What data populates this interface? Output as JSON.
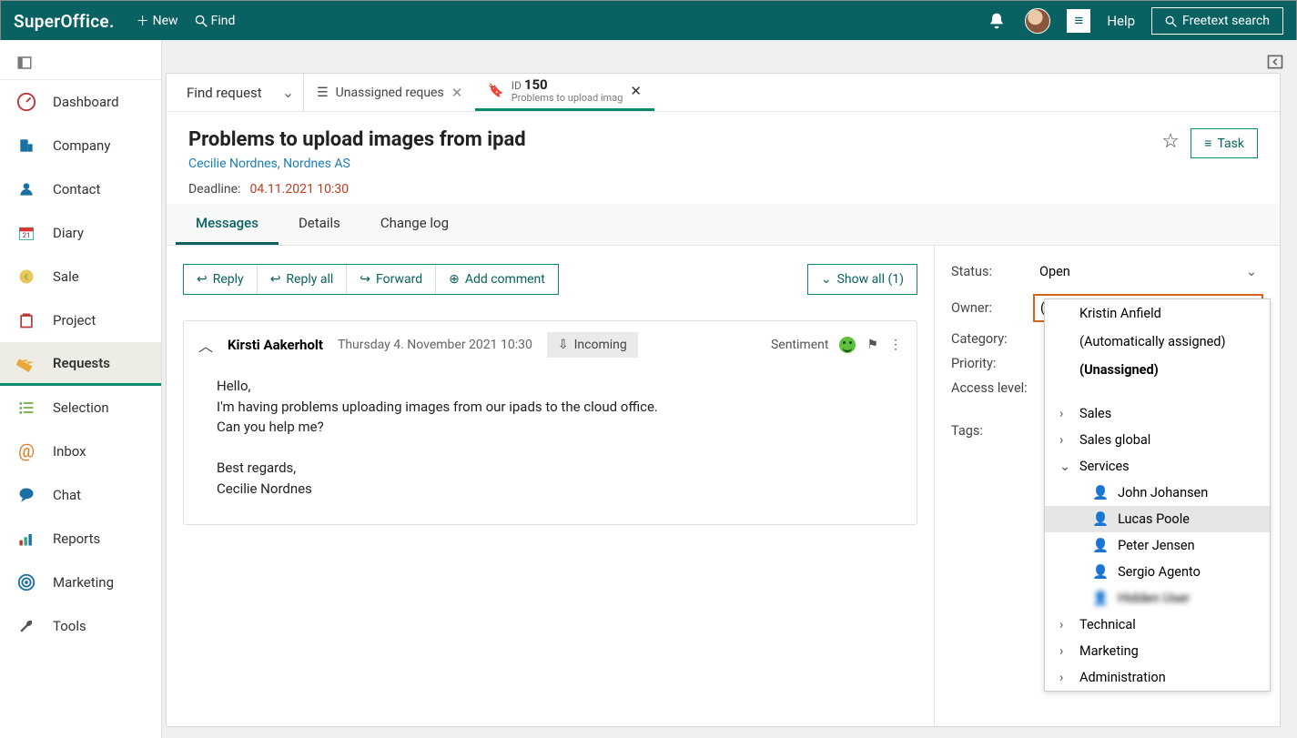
{
  "top": {
    "logo": "SuperOffice",
    "new": "New",
    "find": "Find",
    "help": "Help",
    "freetext": "Freetext search"
  },
  "nav": {
    "items": [
      "Dashboard",
      "Company",
      "Contact",
      "Diary",
      "Sale",
      "Project",
      "Requests",
      "Selection",
      "Inbox",
      "Chat",
      "Reports",
      "Marketing",
      "Tools"
    ],
    "active": "Requests"
  },
  "tabs": {
    "find": "Find request",
    "unassigned": "Unassigned reques",
    "active_id_label": "ID",
    "active_id": "150",
    "active_sub": "Problems to upload imag"
  },
  "request": {
    "title": "Problems to upload images from ipad",
    "contact": "Cecilie Nordnes, Nordnes AS",
    "deadline_label": "Deadline:",
    "deadline_value": "04.11.2021 10:30",
    "task": "Task"
  },
  "subtabs": [
    "Messages",
    "Details",
    "Change log"
  ],
  "actions": {
    "reply": "Reply",
    "reply_all": "Reply all",
    "forward": "Forward",
    "add_comment": "Add comment",
    "show_all": "Show all (1)"
  },
  "message": {
    "author": "Kirsti Aakerholt",
    "time": "Thursday 4. November 2021 10:30",
    "direction": "Incoming",
    "sentiment_label": "Sentiment",
    "body": "Hello,\nI'm having problems uploading images from our ipads to the cloud office.\nCan you help me?\n\nBest regards,\nCecilie Nordnes"
  },
  "details": {
    "status_label": "Status:",
    "status_value": "Open",
    "owner_label": "Owner:",
    "owner_value": "(Unassigned)",
    "category_label": "Category:",
    "priority_label": "Priority:",
    "access_label": "Access level:",
    "tags_label": "Tags:"
  },
  "owner_dropdown": {
    "recent": [
      "Kristin Anfield",
      "(Automatically assigned)",
      "(Unassigned)"
    ],
    "groups": [
      {
        "name": "Sales",
        "open": false
      },
      {
        "name": "Sales global",
        "open": false
      },
      {
        "name": "Services",
        "open": true,
        "users": [
          "John Johansen",
          "Lucas Poole",
          "Peter Jensen",
          "Sergio Agento",
          "blurred"
        ]
      },
      {
        "name": "Technical",
        "open": false
      },
      {
        "name": "Marketing",
        "open": false
      },
      {
        "name": "Administration",
        "open": false
      }
    ],
    "hovered": "Lucas Poole"
  }
}
